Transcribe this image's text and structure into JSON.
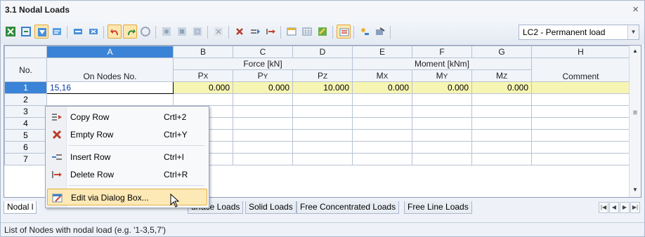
{
  "window": {
    "title": "3.1 Nodal Loads",
    "close_glyph": "×"
  },
  "toolbar": {
    "load_case": "LC2 - Permanent load",
    "icons": [
      "excel-import-icon",
      "excel-export-icon",
      "filter-icon",
      "clear-icon",
      "insert-row-icon",
      "delete-row-icon",
      "undo-icon",
      "selection-icon",
      "show-icon",
      "view-icon",
      "sum-icon",
      "pan-icon",
      "delete-icon",
      "insert-icon",
      "remove-icon",
      "table-icon",
      "columns-icon",
      "edit-icon",
      "graphics-icon",
      "nodes-icon",
      "settings-icon"
    ]
  },
  "grid": {
    "col_letters": [
      "A",
      "B",
      "C",
      "D",
      "E",
      "F",
      "G",
      "H"
    ],
    "group_headers": {
      "force": "Force [kN]",
      "moment": "Moment [kNm]"
    },
    "headers": {
      "no": "No.",
      "nodes": "On Nodes No.",
      "px": "PX",
      "py": "PY",
      "pz": "PZ",
      "mx": "MX",
      "my": "MY",
      "mz": "MZ",
      "comment": "Comment"
    },
    "rows": [
      {
        "no": "1",
        "nodes": "15,16",
        "px": "0.000",
        "py": "0.000",
        "pz": "10.000",
        "mx": "0.000",
        "my": "0.000",
        "mz": "0.000",
        "comment": ""
      },
      {
        "no": "2",
        "nodes": "",
        "px": "",
        "py": "",
        "pz": "",
        "mx": "",
        "my": "",
        "mz": "",
        "comment": ""
      },
      {
        "no": "3",
        "nodes": "",
        "px": "",
        "py": "",
        "pz": "",
        "mx": "",
        "my": "",
        "mz": "",
        "comment": ""
      },
      {
        "no": "4",
        "nodes": "",
        "px": "",
        "py": "",
        "pz": "",
        "mx": "",
        "my": "",
        "mz": "",
        "comment": ""
      },
      {
        "no": "5",
        "nodes": "",
        "px": "",
        "py": "",
        "pz": "",
        "mx": "",
        "my": "",
        "mz": "",
        "comment": ""
      },
      {
        "no": "6",
        "nodes": "",
        "px": "",
        "py": "",
        "pz": "",
        "mx": "",
        "my": "",
        "mz": "",
        "comment": ""
      },
      {
        "no": "7",
        "nodes": "",
        "px": "",
        "py": "",
        "pz": "",
        "mx": "",
        "my": "",
        "mz": "",
        "comment": ""
      }
    ]
  },
  "context_menu": {
    "items": [
      {
        "label": "Copy Row",
        "shortcut": "Crtl+2",
        "icon": "copy-row-icon"
      },
      {
        "label": "Empty Row",
        "shortcut": "Ctrl+Y",
        "icon": "empty-row-icon"
      },
      {
        "label": "Insert Row",
        "shortcut": "Ctrl+I",
        "icon": "insert-row-icon"
      },
      {
        "label": "Delete Row",
        "shortcut": "Ctrl+R",
        "icon": "delete-row-icon"
      },
      {
        "label": "Edit via Dialog Box...",
        "shortcut": "",
        "icon": "edit-dialog-icon"
      }
    ]
  },
  "tabs": {
    "first_partial": "Nodal l",
    "items": [
      "urface Loads",
      "Solid Loads",
      "Free Concentrated Loads",
      "Free Line Loads"
    ]
  },
  "status_text": "List of Nodes with nodal load (e.g. '1-3,5,7')"
}
